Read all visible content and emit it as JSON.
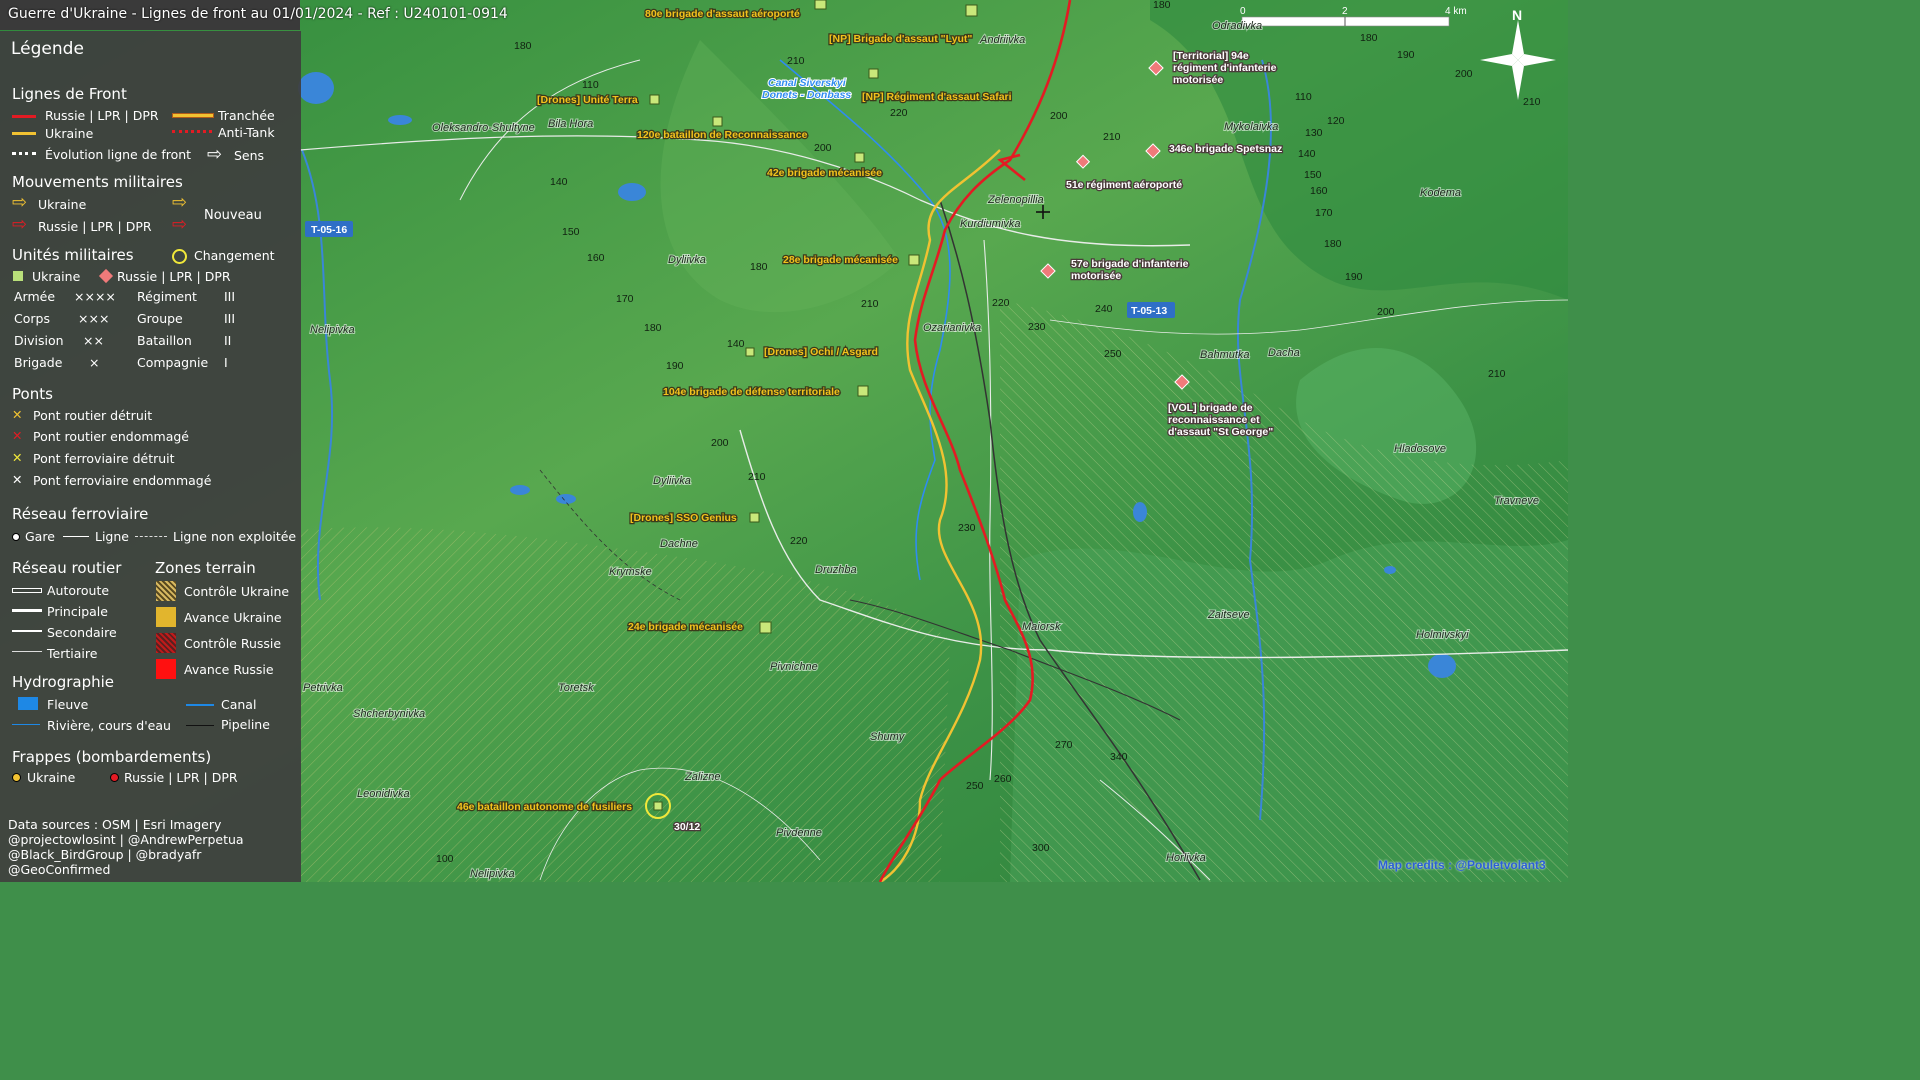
{
  "title": "Guerre d'Ukraine - Lignes de front au 01/01/2024 - Ref : U240101-0914",
  "legend": {
    "heading": "Légende",
    "front_title": "Lignes de Front",
    "front_russia": "Russie | LPR | DPR",
    "front_ukraine": "Ukraine",
    "front_evolution": "Évolution ligne de front",
    "trench": "Tranchée",
    "antitank": "Anti-Tank",
    "direction": "Sens",
    "moves_title": "Mouvements militaires",
    "moves_ukraine": "Ukraine",
    "moves_russia": "Russie | LPR | DPR",
    "moves_new": "Nouveau",
    "units_title": "Unités militaires",
    "units_change": "Changement",
    "units_ukraine": "Ukraine",
    "units_russia": "Russie | LPR | DPR",
    "echelons": [
      {
        "name": "Armée",
        "sym": "××××",
        "name2": "Régiment",
        "sym2": "III"
      },
      {
        "name": "Corps",
        "sym": "×××",
        "name2": "Groupe",
        "sym2": "III"
      },
      {
        "name": "Division",
        "sym": "××",
        "name2": "Bataillon",
        "sym2": "II"
      },
      {
        "name": "Brigade",
        "sym": "×",
        "name2": "Compagnie",
        "sym2": "I"
      }
    ],
    "bridges_title": "Ponts",
    "bridges": [
      "Pont routier détruit",
      "Pont routier endommagé",
      "Pont ferroviaire détruit",
      "Pont ferroviaire endommagé"
    ],
    "rail_title": "Réseau ferroviaire",
    "rail_station": "Gare",
    "rail_line": "Ligne",
    "rail_unused": "Ligne non exploitée",
    "road_title": "Réseau routier",
    "roads": [
      "Autoroute",
      "Principale",
      "Secondaire",
      "Tertiaire"
    ],
    "zones_title": "Zones terrain",
    "zones": [
      "Contrôle Ukraine",
      "Avance Ukraine",
      "Contrôle Russie",
      "Avance Russie"
    ],
    "hydro_title": "Hydrographie",
    "hydro_river": "Fleuve",
    "hydro_stream": "Rivière, cours d'eau",
    "hydro_canal": "Canal",
    "hydro_pipeline": "Pipeline",
    "strikes_title": "Frappes (bombardements)",
    "strikes_ukraine": "Ukraine",
    "strikes_russia": "Russie | LPR | DPR"
  },
  "credits": [
    "Data sources : OSM | Esri Imagery",
    "@projectowlosint | @AndrewPerpetua",
    "@Black_BirdGroup | @bradyafr",
    "@GeoConfirmed"
  ],
  "scale": {
    "zero": "0",
    "mid": "2",
    "end": "4 km"
  },
  "north": "N",
  "map_credit": "Map credits : @Pouletvolant3",
  "roads_ids": [
    "T-05-16",
    "T-05-13"
  ],
  "units_ukraine": [
    "80e brigade d'assaut aéroporté",
    "[NP] Brigade d'assaut \"Lyut\"",
    "[NP] Régiment d'assaut Safari",
    "[Drones] Unité Terra",
    "120e bataillon de Reconnaissance",
    "42e brigade mécanisée",
    "28e brigade mécanisée",
    "[Drones] Ochi / Asgard",
    "104e brigade de défense territoriale",
    "[Drones] SSO Genius",
    "24e brigade mécanisée",
    "46e bataillon autonome de fusiliers"
  ],
  "units_russia": [
    [
      "[Territorial] 94e",
      "régiment d'infanterie",
      "motorisée"
    ],
    [
      "346e brigade Spetsnaz"
    ],
    [
      "51e régiment aéroporté"
    ],
    [
      "57e brigade d'infanterie",
      "motorisée"
    ],
    [
      "[VOL] brigade de",
      "reconnaissance et",
      "d'assaut \"St George\""
    ]
  ],
  "change_date": "30/12",
  "canal_label": [
    "Canal Siverskyi",
    "Donets - Donbass"
  ],
  "towns": [
    "Andriivka",
    "Odradivka",
    "Oleksandro-Shultyne",
    "Bila Hora",
    "Mykolaivka",
    "Kodema",
    "Zelenopillia",
    "Kurdiumivka",
    "Dyliivka",
    "Nelipivka",
    "Ozarianivka",
    "Bahmutka",
    "Dacha",
    "Hladosove",
    "Dyliivka",
    "Travneve",
    "Dachne",
    "Krymske",
    "Druzhba",
    "Zaitseve",
    "Maiorsk",
    "Holmivskyi",
    "Pivnichne",
    "Toretsk",
    "Shcherbynivka",
    "Shumy",
    "Zalizne",
    "Leonidivka",
    "Pivdenne",
    "Horlivka",
    "Nelipivka",
    "Petrivka"
  ],
  "elevations": [
    "180",
    "210",
    "180",
    "180",
    "190",
    "210",
    "110",
    "220",
    "200",
    "110",
    "210",
    "200",
    "130",
    "120",
    "140",
    "140",
    "150",
    "160",
    "180",
    "170",
    "150",
    "160",
    "190",
    "200",
    "210",
    "180",
    "220",
    "240",
    "230",
    "250",
    "200",
    "170",
    "180",
    "190",
    "140",
    "200",
    "210",
    "210",
    "230",
    "220",
    "270",
    "340",
    "250",
    "260",
    "300",
    "100"
  ]
}
